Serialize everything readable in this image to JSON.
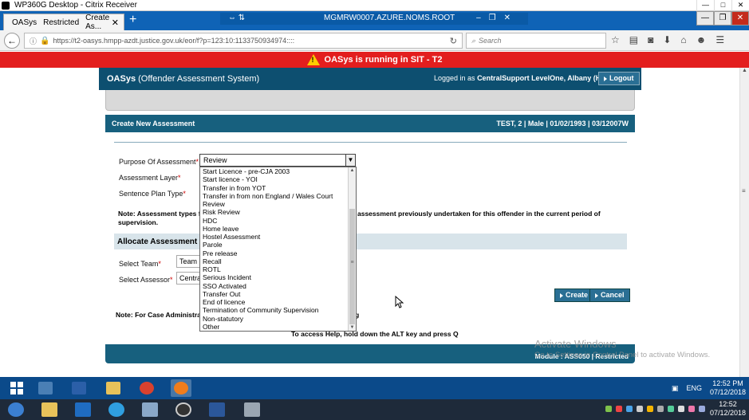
{
  "citrix": {
    "title": "WP360G Desktop - Citrix Receiver",
    "controls": [
      "—",
      "□",
      "✕"
    ]
  },
  "browser": {
    "tab_title": "OASys",
    "tab_restricted": "Restricted",
    "tab_create": "Create As...",
    "remote_session": "MGMRW0007.AZURE.NOMS.ROOT",
    "url": "https://t2-oasys.hmpp-azdt.justice.gov.uk/eor/f?p=123:10:1133750934974::::",
    "search_placeholder": "Search"
  },
  "banner": {
    "text": "OASys is running in SIT - T2",
    "color": "#e31e1e"
  },
  "header": {
    "app_name": "OASys",
    "app_full": "(Offender Assessment System)",
    "login_prefix": "Logged in as",
    "login_user": "CentralSupport LevelOne, Albany (HMP)",
    "logout_label": "Logout"
  },
  "panel": {
    "title": "Create New Assessment",
    "person": "TEST, 2 | Male | 01/02/1993 | 03/12007W"
  },
  "form": {
    "purpose_label": "Purpose Of Assessment",
    "purpose_value": "Review",
    "layer_label": "Assessment Layer",
    "sentence_label": "Sentence Plan Type",
    "required_marker": "*",
    "note_left": "Note: Assessment types fr",
    "note_right": "assessment previously undertaken for this offender in the current period of",
    "note_line2": "supervision."
  },
  "allocate": {
    "title": "Allocate Assessment",
    "team_label": "Select Team",
    "team_value": "Team A",
    "assessor_label": "Select Assessor",
    "assessor_value": "Central"
  },
  "buttons": {
    "create": "Create",
    "cancel": "Cancel"
  },
  "notes": {
    "case_admin": "Note: For Case Administrato",
    "case_admin_trail": "g",
    "help": "To access Help, hold down the ALT key and press Q"
  },
  "footer": {
    "module": "Module : ASS050 | Restricted"
  },
  "watermark": {
    "title": "Activate Windows",
    "subtitle": "Go to Settings in Control Panel to activate Windows."
  },
  "dropdown_options": [
    "Start Licence - pre-CJA 2003",
    "Start licence - YOI",
    "Transfer in from YOT",
    "Transfer in from non England / Wales Court",
    "Review",
    "Risk Review",
    "HDC",
    "Home leave",
    "Hostel Assessment",
    "Parole",
    "Pre release",
    "Recall",
    "ROTL",
    "Serious Incident",
    "SSO Activated",
    "Transfer Out",
    "End of licence",
    "Termination of Community Supervision",
    "Non-statutory",
    "Other"
  ],
  "taskbar": {
    "lang": "ENG",
    "time": "12:52 PM",
    "date": "07/12/2018",
    "host_time": "12:52",
    "host_date": "07/12/2018"
  }
}
